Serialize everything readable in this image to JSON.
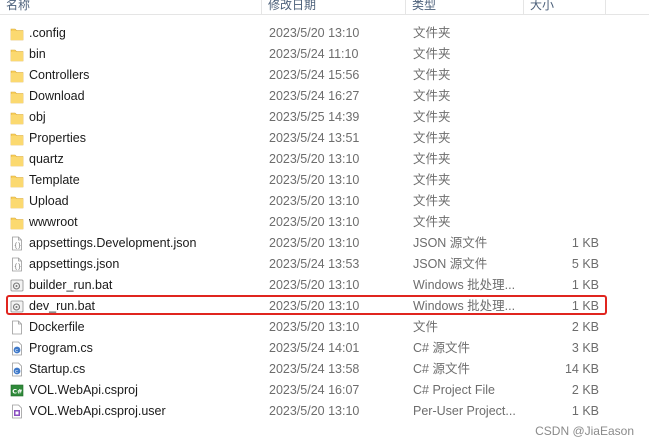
{
  "header": {
    "col_name": "名称",
    "col_date": "修改日期",
    "col_type": "类型",
    "col_size": "大小"
  },
  "rows": [
    {
      "name": ".config",
      "date": "2023/5/20 13:10",
      "type": "文件夹",
      "size": "",
      "icon": "folder-icon"
    },
    {
      "name": "bin",
      "date": "2023/5/24 11:10",
      "type": "文件夹",
      "size": "",
      "icon": "folder-icon"
    },
    {
      "name": "Controllers",
      "date": "2023/5/24 15:56",
      "type": "文件夹",
      "size": "",
      "icon": "folder-icon"
    },
    {
      "name": "Download",
      "date": "2023/5/24 16:27",
      "type": "文件夹",
      "size": "",
      "icon": "folder-icon"
    },
    {
      "name": "obj",
      "date": "2023/5/25 14:39",
      "type": "文件夹",
      "size": "",
      "icon": "folder-icon"
    },
    {
      "name": "Properties",
      "date": "2023/5/24 13:51",
      "type": "文件夹",
      "size": "",
      "icon": "folder-icon"
    },
    {
      "name": "quartz",
      "date": "2023/5/20 13:10",
      "type": "文件夹",
      "size": "",
      "icon": "folder-icon"
    },
    {
      "name": "Template",
      "date": "2023/5/20 13:10",
      "type": "文件夹",
      "size": "",
      "icon": "folder-icon"
    },
    {
      "name": "Upload",
      "date": "2023/5/20 13:10",
      "type": "文件夹",
      "size": "",
      "icon": "folder-icon"
    },
    {
      "name": "wwwroot",
      "date": "2023/5/20 13:10",
      "type": "文件夹",
      "size": "",
      "icon": "folder-icon"
    },
    {
      "name": "appsettings.Development.json",
      "date": "2023/5/20 13:10",
      "type": "JSON 源文件",
      "size": "1 KB",
      "icon": "json-file-icon"
    },
    {
      "name": "appsettings.json",
      "date": "2023/5/24 13:53",
      "type": "JSON 源文件",
      "size": "5 KB",
      "icon": "json-file-icon"
    },
    {
      "name": "builder_run.bat",
      "date": "2023/5/20 13:10",
      "type": "Windows 批处理...",
      "size": "1 KB",
      "icon": "batch-file-icon"
    },
    {
      "name": "dev_run.bat",
      "date": "2023/5/20 13:10",
      "type": "Windows 批处理...",
      "size": "1 KB",
      "icon": "batch-file-icon"
    },
    {
      "name": "Dockerfile",
      "date": "2023/5/20 13:10",
      "type": "文件",
      "size": "2 KB",
      "icon": "blank-file-icon"
    },
    {
      "name": "Program.cs",
      "date": "2023/5/24 14:01",
      "type": "C# 源文件",
      "size": "3 KB",
      "icon": "csharp-file-icon"
    },
    {
      "name": "Startup.cs",
      "date": "2023/5/24 13:58",
      "type": "C# 源文件",
      "size": "14 KB",
      "icon": "csharp-file-icon"
    },
    {
      "name": "VOL.WebApi.csproj",
      "date": "2023/5/24 16:07",
      "type": "C# Project File",
      "size": "2 KB",
      "icon": "csproj-file-icon"
    },
    {
      "name": "VOL.WebApi.csproj.user",
      "date": "2023/5/20 13:10",
      "type": "Per-User Project...",
      "size": "1 KB",
      "icon": "csproj-user-file-icon"
    }
  ],
  "watermark": "CSDN @JiaEason",
  "colors": {
    "highlight": "#e0251f",
    "folder": "#f8cf5b",
    "header_text": "#4c607a"
  }
}
